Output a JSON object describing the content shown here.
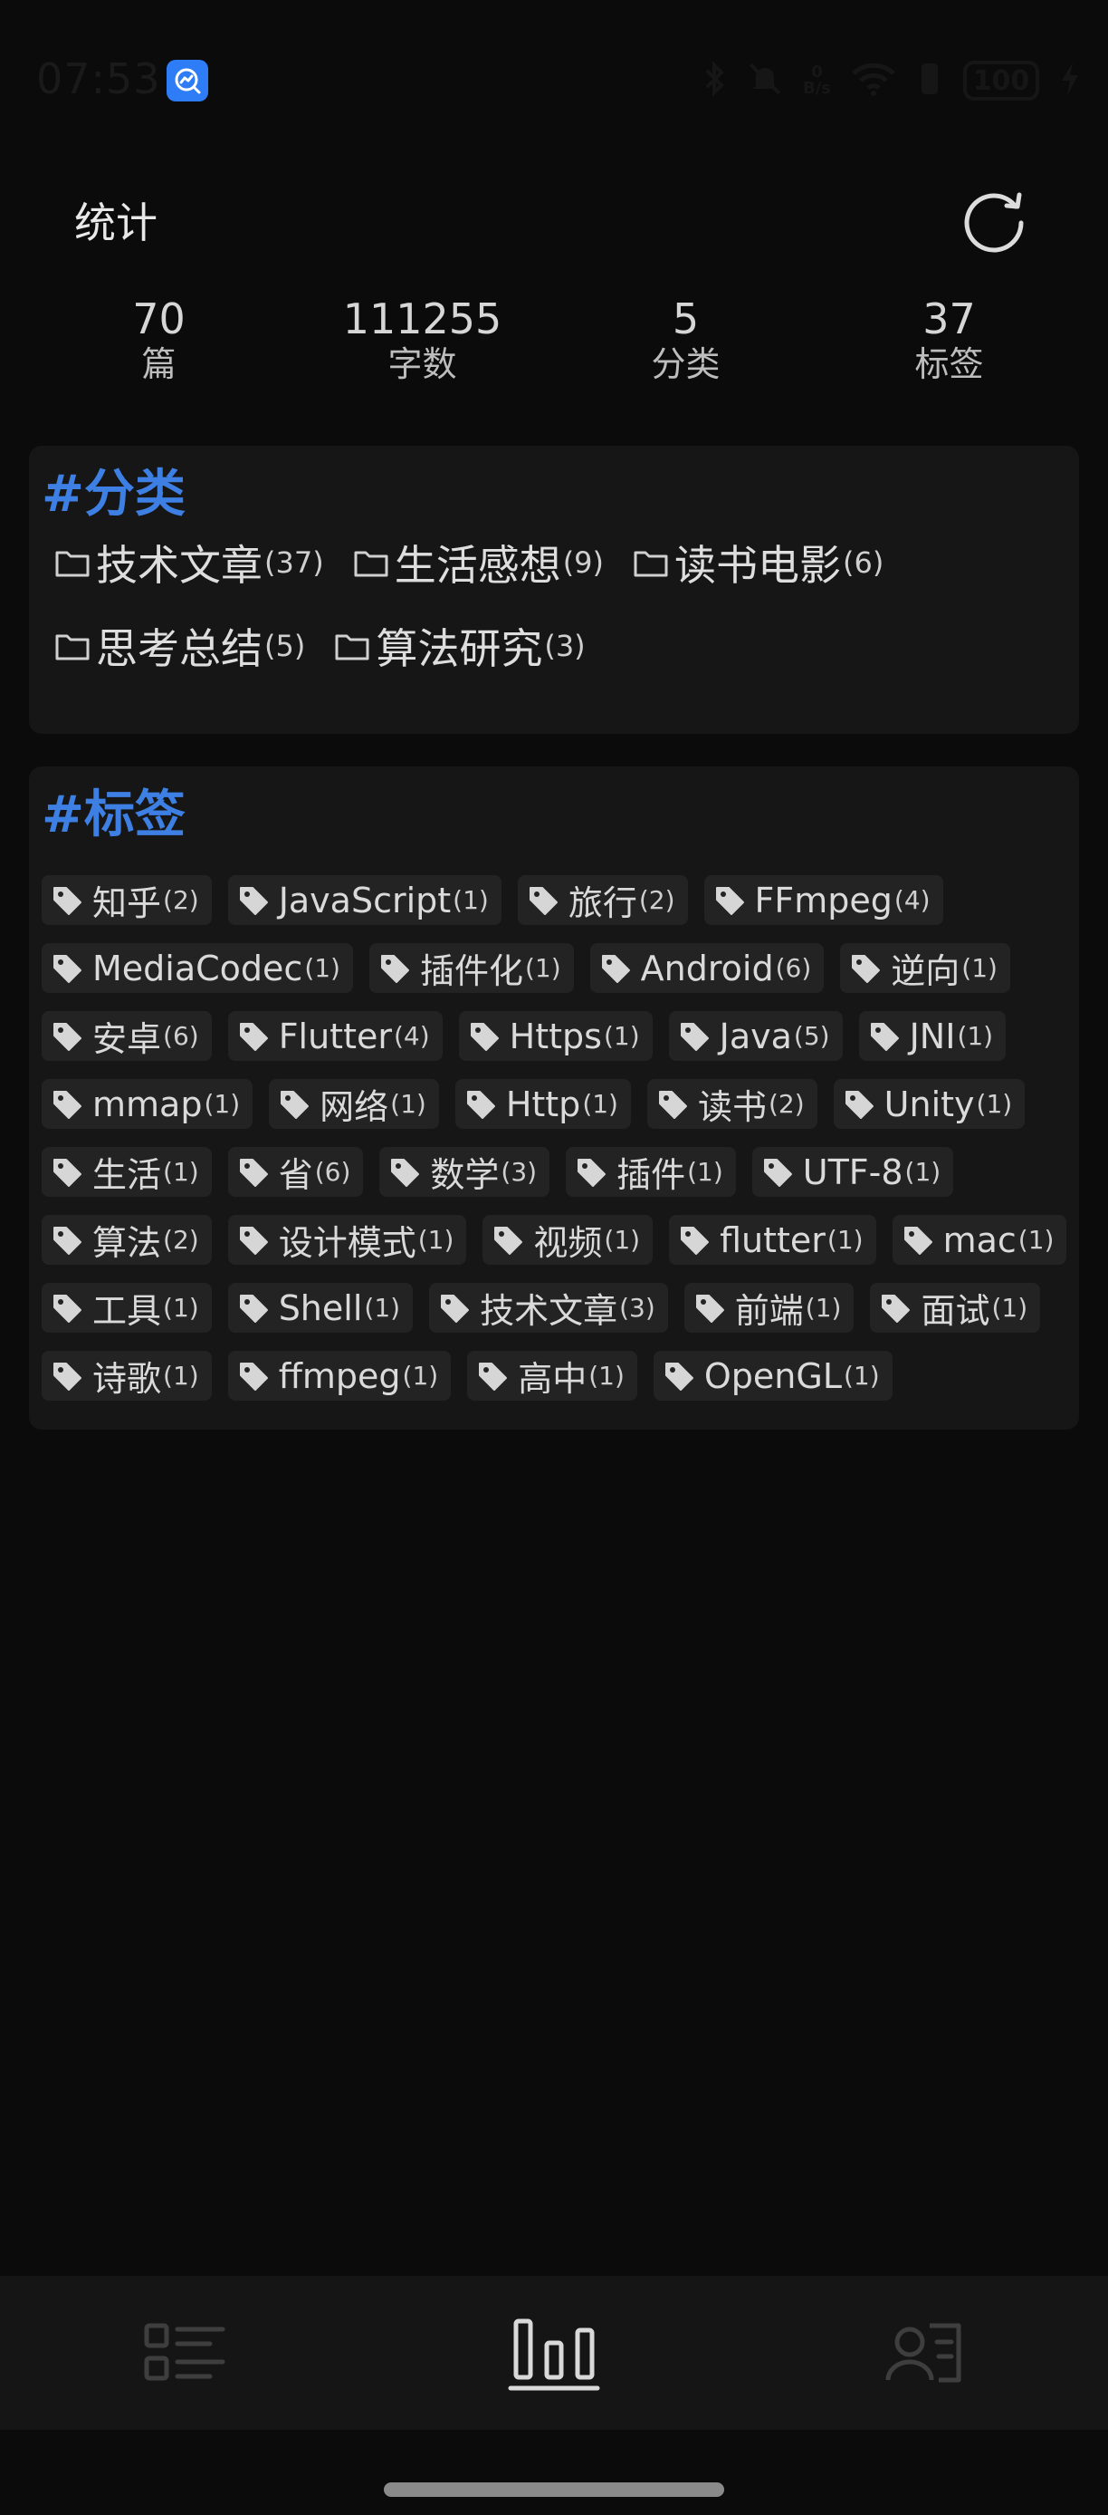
{
  "status_bar": {
    "time": "07:53",
    "battery": "100",
    "net_speed_value": "0",
    "net_speed_unit": "B/s"
  },
  "header": {
    "title": "统计"
  },
  "stats": [
    {
      "value": "70",
      "label": "篇"
    },
    {
      "value": "111255",
      "label": "字数"
    },
    {
      "value": "5",
      "label": "分类"
    },
    {
      "value": "37",
      "label": "标签"
    }
  ],
  "categories": {
    "title": "#分类",
    "items": [
      {
        "name": "技术文章",
        "count": "(37)"
      },
      {
        "name": "生活感想",
        "count": "(9)"
      },
      {
        "name": "读书电影",
        "count": "(6)"
      },
      {
        "name": "思考总结",
        "count": "(5)"
      },
      {
        "name": "算法研究",
        "count": "(3)"
      }
    ]
  },
  "tags": {
    "title": "#标签",
    "items": [
      {
        "name": "知乎",
        "count": "(2)"
      },
      {
        "name": "JavaScript",
        "count": "(1)"
      },
      {
        "name": "旅行",
        "count": "(2)"
      },
      {
        "name": "FFmpeg",
        "count": "(4)"
      },
      {
        "name": "MediaCodec",
        "count": "(1)"
      },
      {
        "name": "插件化",
        "count": "(1)"
      },
      {
        "name": "Android",
        "count": "(6)"
      },
      {
        "name": "逆向",
        "count": "(1)"
      },
      {
        "name": "安卓",
        "count": "(6)"
      },
      {
        "name": "Flutter",
        "count": "(4)"
      },
      {
        "name": "Https",
        "count": "(1)"
      },
      {
        "name": "Java",
        "count": "(5)"
      },
      {
        "name": "JNI",
        "count": "(1)"
      },
      {
        "name": "mmap",
        "count": "(1)"
      },
      {
        "name": "网络",
        "count": "(1)"
      },
      {
        "name": "Http",
        "count": "(1)"
      },
      {
        "name": "读书",
        "count": "(2)"
      },
      {
        "name": "Unity",
        "count": "(1)"
      },
      {
        "name": "生活",
        "count": "(1)"
      },
      {
        "name": "省",
        "count": "(6)"
      },
      {
        "name": "数学",
        "count": "(3)"
      },
      {
        "name": "插件",
        "count": "(1)"
      },
      {
        "name": "UTF-8",
        "count": "(1)"
      },
      {
        "name": "算法",
        "count": "(2)"
      },
      {
        "name": "设计模式",
        "count": "(1)"
      },
      {
        "name": "视频",
        "count": "(1)"
      },
      {
        "name": "flutter",
        "count": "(1)"
      },
      {
        "name": "mac",
        "count": "(1)"
      },
      {
        "name": "工具",
        "count": "(1)"
      },
      {
        "name": "Shell",
        "count": "(1)"
      },
      {
        "name": "技术文章",
        "count": "(3)"
      },
      {
        "name": "前端",
        "count": "(1)"
      },
      {
        "name": "面试",
        "count": "(1)"
      },
      {
        "name": "诗歌",
        "count": "(1)"
      },
      {
        "name": "ffmpeg",
        "count": "(1)"
      },
      {
        "name": "高中",
        "count": "(1)"
      },
      {
        "name": "OpenGL",
        "count": "(1)"
      }
    ]
  },
  "bottom_nav": [
    {
      "icon": "list-icon",
      "active": false
    },
    {
      "icon": "bar-chart-icon",
      "active": true
    },
    {
      "icon": "profile-card-icon",
      "active": false
    }
  ],
  "colors": {
    "accent": "#3d7fe3",
    "background": "#0b0b0b",
    "card": "#161616",
    "chip": "#232323"
  }
}
